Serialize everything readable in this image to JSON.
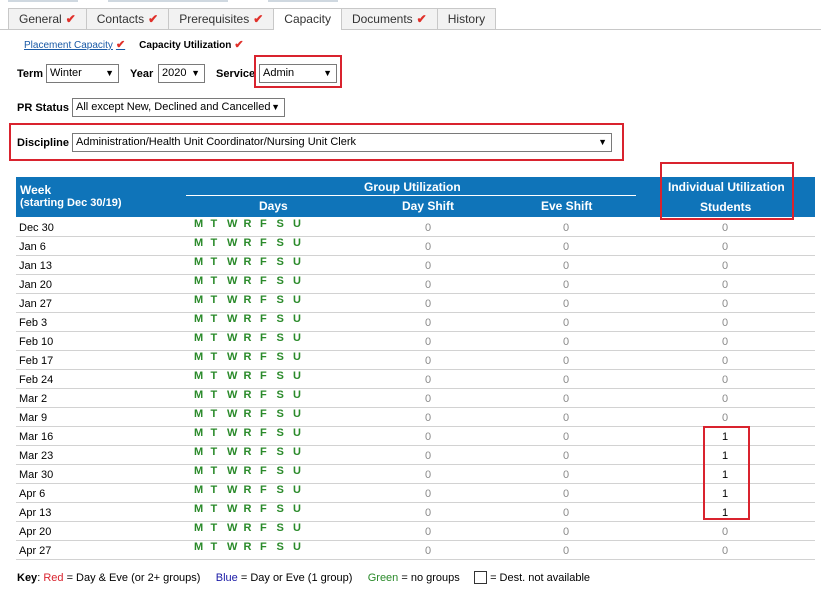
{
  "tabs": [
    {
      "label": "General",
      "check": "✔"
    },
    {
      "label": "Contacts",
      "check": "✔"
    },
    {
      "label": "Prerequisites",
      "check": "✔"
    },
    {
      "label": "Capacity",
      "check": ""
    },
    {
      "label": "Documents",
      "check": "✔"
    },
    {
      "label": "History",
      "check": ""
    }
  ],
  "subtabs": {
    "placement_capacity": "Placement Capacity",
    "capacity_utilization": "Capacity Utilization",
    "check": "✔"
  },
  "filters": {
    "term_label": "Term",
    "term_value": "Winter",
    "year_label": "Year",
    "year_value": "2020",
    "service_label": "Service",
    "service_value": "Admin",
    "pr_status_label": "PR Status",
    "pr_status_value": "All except New, Declined and Cancelled",
    "discipline_label": "Discipline",
    "discipline_value": "Administration/Health Unit Coordinator/Nursing Unit Clerk",
    "dropdown_arrow": "▼"
  },
  "table": {
    "week_header_line1": "Week",
    "week_header_line2": "(starting Dec 30/19)",
    "group_utilization": "Group Utilization",
    "days_header": "Days",
    "day_shift_header": "Day Shift",
    "eve_shift_header": "Eve Shift",
    "individual_utilization": "Individual Utilization",
    "students_header": "Students",
    "day_letters": [
      "M",
      "T",
      "W",
      "R",
      "F",
      "S",
      "U"
    ],
    "rows": [
      {
        "week": "Dec 30",
        "day_shift": "0",
        "eve_shift": "0",
        "students": "0"
      },
      {
        "week": "Jan 6",
        "day_shift": "0",
        "eve_shift": "0",
        "students": "0"
      },
      {
        "week": "Jan 13",
        "day_shift": "0",
        "eve_shift": "0",
        "students": "0"
      },
      {
        "week": "Jan 20",
        "day_shift": "0",
        "eve_shift": "0",
        "students": "0"
      },
      {
        "week": "Jan 27",
        "day_shift": "0",
        "eve_shift": "0",
        "students": "0"
      },
      {
        "week": "Feb 3",
        "day_shift": "0",
        "eve_shift": "0",
        "students": "0"
      },
      {
        "week": "Feb 10",
        "day_shift": "0",
        "eve_shift": "0",
        "students": "0"
      },
      {
        "week": "Feb 17",
        "day_shift": "0",
        "eve_shift": "0",
        "students": "0"
      },
      {
        "week": "Feb 24",
        "day_shift": "0",
        "eve_shift": "0",
        "students": "0"
      },
      {
        "week": "Mar 2",
        "day_shift": "0",
        "eve_shift": "0",
        "students": "0"
      },
      {
        "week": "Mar 9",
        "day_shift": "0",
        "eve_shift": "0",
        "students": "0"
      },
      {
        "week": "Mar 16",
        "day_shift": "0",
        "eve_shift": "0",
        "students": "1"
      },
      {
        "week": "Mar 23",
        "day_shift": "0",
        "eve_shift": "0",
        "students": "1"
      },
      {
        "week": "Mar 30",
        "day_shift": "0",
        "eve_shift": "0",
        "students": "1"
      },
      {
        "week": "Apr 6",
        "day_shift": "0",
        "eve_shift": "0",
        "students": "1"
      },
      {
        "week": "Apr 13",
        "day_shift": "0",
        "eve_shift": "0",
        "students": "1"
      },
      {
        "week": "Apr 20",
        "day_shift": "0",
        "eve_shift": "0",
        "students": "0"
      },
      {
        "week": "Apr 27",
        "day_shift": "0",
        "eve_shift": "0",
        "students": "0"
      }
    ]
  },
  "key": {
    "label": "Key",
    "red_word": "Red",
    "red_text": "= Day & Eve (or 2+ groups)",
    "blue_word": "Blue",
    "blue_text": "= Day or Eve (1 group)",
    "green_word": "Green",
    "green_text": "= no groups",
    "na_text": "= Dest. not available"
  },
  "colors": {
    "header_blue": "#0f74b9",
    "day_green": "#2a8a2a",
    "highlight_red": "#d9232e",
    "check_red": "#e0302a"
  }
}
